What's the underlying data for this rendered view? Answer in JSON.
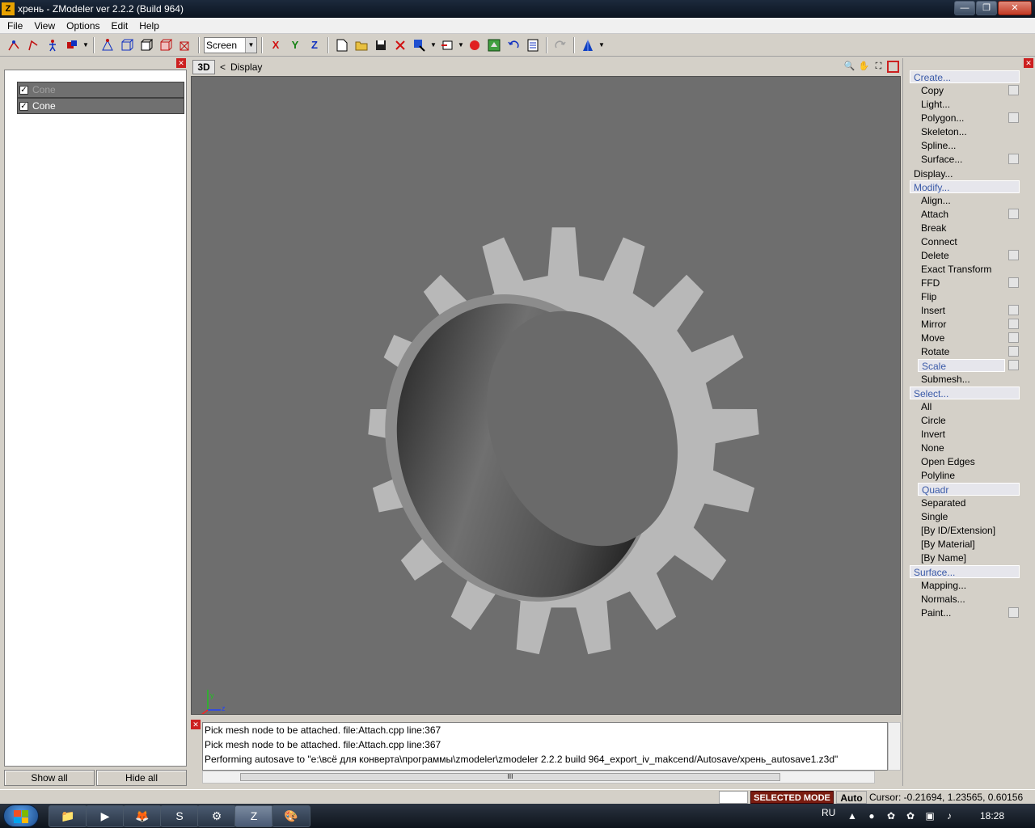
{
  "window": {
    "title": "хрень - ZModeler ver 2.2.2 (Build 964)",
    "icon_letter": "Z",
    "btn_minimize": "—",
    "btn_maximize": "❐",
    "btn_close": "✕"
  },
  "menu": [
    "File",
    "View",
    "Options",
    "Edit",
    "Help"
  ],
  "toolbar": {
    "screen_select": "Screen",
    "axes": [
      "X",
      "Y",
      "Z"
    ]
  },
  "scene_tree": {
    "rows": [
      {
        "label": "Cone",
        "checked": true,
        "dimmed": true
      },
      {
        "label": "Cone",
        "checked": true,
        "dimmed": false
      }
    ],
    "show_all": "Show all",
    "hide_all": "Hide all"
  },
  "viewport": {
    "mode": "3D",
    "breadcrumb_sep": "<",
    "breadcrumb": "Display",
    "background": "#6e6e6e",
    "axis_y": "y",
    "axis_z": "z"
  },
  "log": {
    "lines": [
      "Pick mesh node to be attached. file:Attach.cpp line:367",
      "Pick mesh node to be attached. file:Attach.cpp line:367",
      "Performing autosave to \"e:\\всё для конверта\\программы\\zmodeler\\zmodeler 2.2.2 build 964_export_iv_makcend/Autosave/хрень_autosave1.z3d\""
    ]
  },
  "commands": {
    "create": {
      "label": "Create...",
      "items": [
        "Copy",
        "Light...",
        "Polygon...",
        "Skeleton...",
        "Spline...",
        "Surface..."
      ]
    },
    "display": {
      "label": "Display..."
    },
    "modify": {
      "label": "Modify...",
      "items": [
        "Align...",
        "Attach",
        "Break",
        "Connect",
        "Delete",
        "Exact Transform",
        "FFD",
        "Flip",
        "Insert",
        "Mirror",
        "Move",
        "Rotate",
        "Scale",
        "Submesh..."
      ]
    },
    "select": {
      "label": "Select...",
      "items": [
        "All",
        "Circle",
        "Invert",
        "None",
        "Open Edges",
        "Polyline",
        "Quadr",
        "Separated",
        "Single",
        "[By ID/Extension]",
        "[By Material]",
        "[By Name]"
      ]
    },
    "surface": {
      "label": "Surface...",
      "items": [
        "Mapping...",
        "Normals...",
        "Paint..."
      ]
    }
  },
  "status": {
    "mode": "SELECTED MODE",
    "auto": "Auto",
    "cursor": "Cursor: -0.21694, 1.23565, 0.60156"
  },
  "taskbar": {
    "lang": "RU",
    "time": "18:28"
  }
}
